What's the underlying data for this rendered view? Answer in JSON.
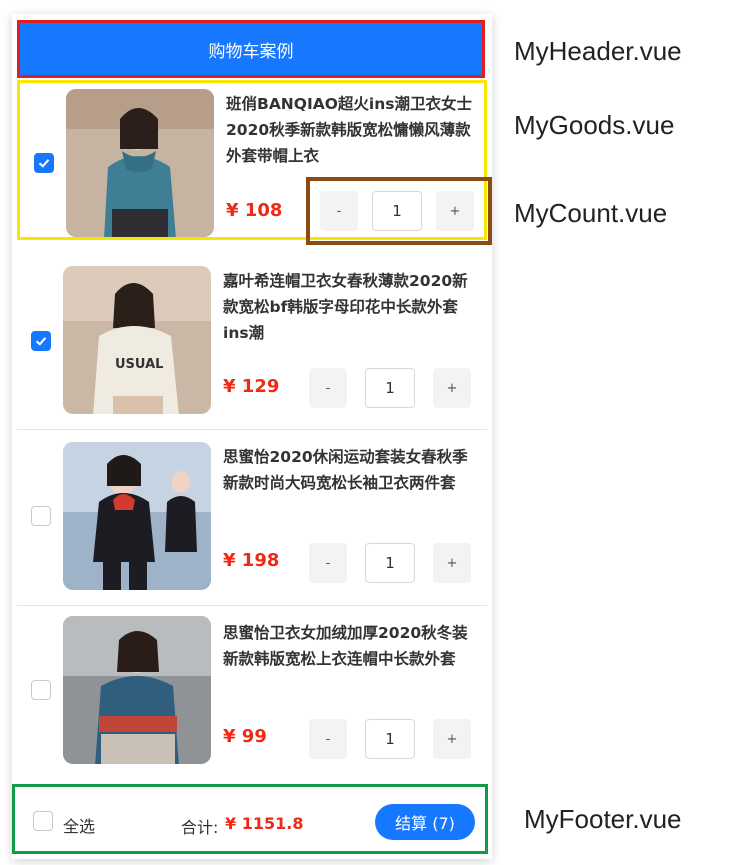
{
  "header": {
    "title": "购物车案例"
  },
  "annotations": {
    "header": "MyHeader.vue",
    "goods": "MyGoods.vue",
    "count": "MyCount.vue",
    "footer": "MyFooter.vue"
  },
  "goods": [
    {
      "title": "班俏BANQIAO超火ins潮卫衣女士2020秋季新款韩版宽松慵懒风薄款外套带帽上衣",
      "price": "¥ 108",
      "count": "1",
      "checked": true
    },
    {
      "title": "嘉叶希连帽卫衣女春秋薄款2020新款宽松bf韩版字母印花中长款外套ins潮",
      "price": "¥ 129",
      "count": "1",
      "checked": true
    },
    {
      "title": "思蜜怡2020休闲运动套装女春秋季新款时尚大码宽松长袖卫衣两件套",
      "price": "¥ 198",
      "count": "1",
      "checked": false
    },
    {
      "title": "思蜜怡卫衣女加绒加厚2020秋冬装新款韩版宽松上衣连帽中长款外套",
      "price": "¥ 99",
      "count": "1",
      "checked": false
    }
  ],
  "counter": {
    "minus": "-",
    "plus": "+"
  },
  "footer": {
    "select_all_label": "全选",
    "total_label": "合计:",
    "total_value": "¥ 1151.8",
    "settle_label": "结算 (7)"
  },
  "colors": {
    "primary": "#1677ff",
    "price": "#ee2a16"
  }
}
